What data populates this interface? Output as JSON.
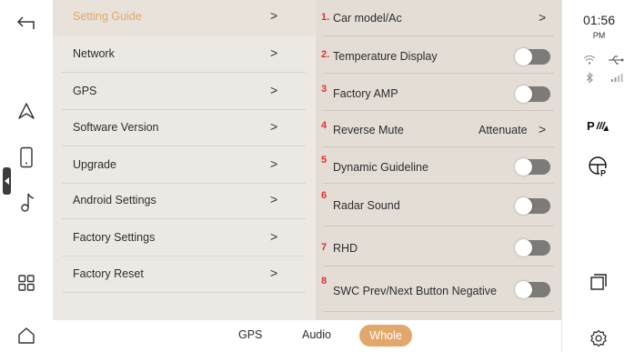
{
  "menu": {
    "items": [
      {
        "label": "Setting Guide",
        "active": true
      },
      {
        "label": "Network"
      },
      {
        "label": "GPS"
      },
      {
        "label": "Software Version"
      },
      {
        "label": "Upgrade"
      },
      {
        "label": "Android Settings"
      },
      {
        "label": "Factory Settings"
      },
      {
        "label": "Factory Reset"
      }
    ],
    "chevron": ">"
  },
  "detail": {
    "rows": [
      {
        "num": "1.",
        "label": "Car model/Ac",
        "control": "chevron"
      },
      {
        "num": "2.",
        "label": "Temperature Display",
        "control": "toggle",
        "state": "off"
      },
      {
        "num": "3",
        "label": "Factory AMP",
        "control": "toggle",
        "state": "off"
      },
      {
        "num": "4",
        "label": "Reverse Mute",
        "control": "value",
        "value": "Attenuate"
      },
      {
        "num": "5",
        "label": "Dynamic Guideline",
        "control": "toggle",
        "state": "off"
      },
      {
        "num": "6",
        "label": "Radar Sound",
        "control": "toggle",
        "state": "off"
      },
      {
        "num": "7",
        "label": "RHD",
        "control": "toggle",
        "state": "off"
      },
      {
        "num": "8",
        "label": "SWC Prev/Next Button Negative",
        "control": "toggle",
        "state": "off"
      }
    ],
    "chevron": ">"
  },
  "bottom_tabs": {
    "gps": "GPS",
    "audio": "Audio",
    "whole": "Whole",
    "active": "Whole"
  },
  "status": {
    "time": "01:56",
    "ampm": "PM"
  },
  "icons": {
    "back": "back-arrow-icon",
    "navigation": "navigation-icon",
    "phone": "phone-icon",
    "music": "music-icon",
    "apps": "apps-grid-icon",
    "home": "home-icon",
    "wifi": "wifi-icon",
    "usb": "usb-icon",
    "bluetooth": "bluetooth-icon",
    "signal": "signal-icon",
    "parking_sensor": "parking-sensor-icon",
    "steering_wheel": "steering-wheel-icon",
    "recent_apps": "recent-apps-icon",
    "settings": "settings-icon"
  },
  "colors": {
    "accent": "#e2a86b",
    "number_red": "#e03030",
    "menu_bg": "#ece9e4",
    "detail_bg": "#e3ddd6",
    "toggle_off": "#7d7b78"
  }
}
